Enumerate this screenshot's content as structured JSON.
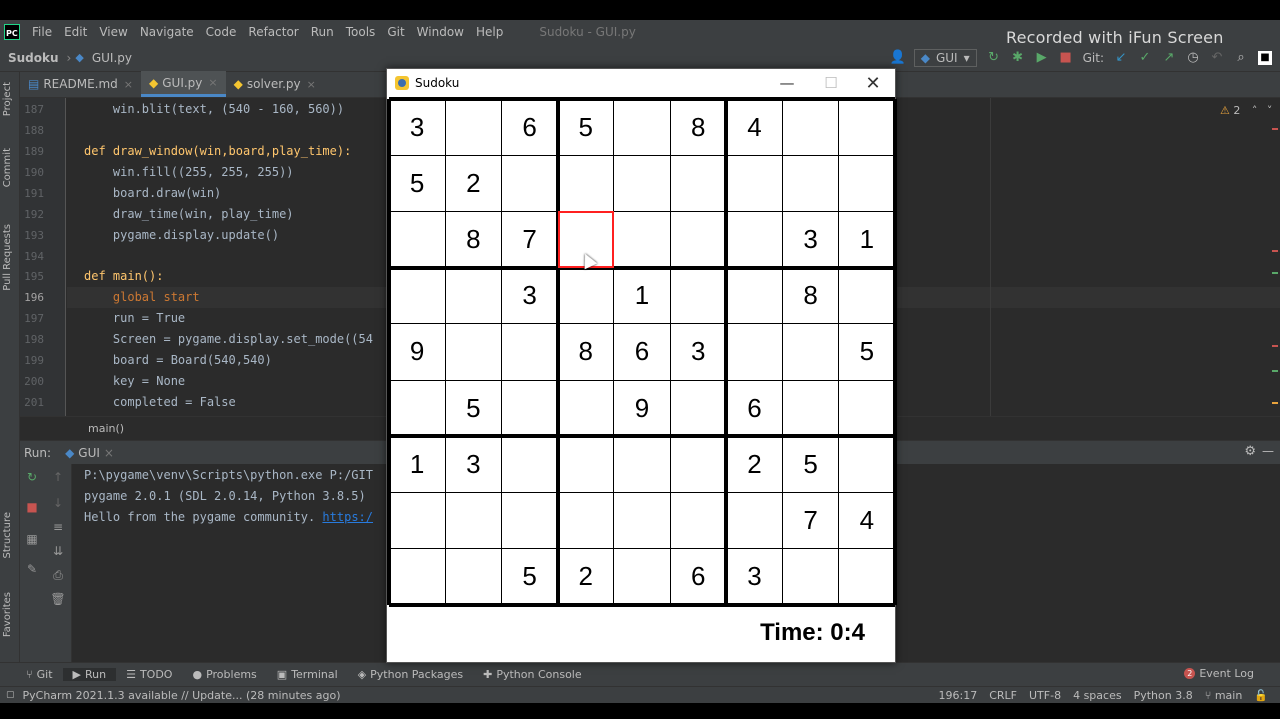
{
  "menubar": {
    "items": [
      "File",
      "Edit",
      "View",
      "Navigate",
      "Code",
      "Refactor",
      "Run",
      "Tools",
      "Git",
      "Window",
      "Help"
    ],
    "window_title": "Sudoku - GUI.py"
  },
  "watermark": "Recorded with iFun Screen Recorder",
  "navbar": {
    "project": "Sudoku",
    "file": "GUI.py",
    "run_config": "GUI",
    "git_label": "Git:"
  },
  "tabs": [
    {
      "label": "README.md",
      "active": false
    },
    {
      "label": "GUI.py",
      "active": true
    },
    {
      "label": "solver.py",
      "active": false
    }
  ],
  "left_tools": [
    "Project",
    "Commit",
    "Pull Requests",
    "Structure",
    "Favorites"
  ],
  "editor": {
    "warning_count": "2",
    "lines": [
      {
        "n": "187",
        "text": "    win.blit(text, (540 - 160, 560))"
      },
      {
        "n": "188",
        "text": ""
      },
      {
        "n": "189",
        "text": "def draw_window(win,board,play_time):"
      },
      {
        "n": "190",
        "text": "    win.fill((255, 255, 255))"
      },
      {
        "n": "191",
        "text": "    board.draw(win)"
      },
      {
        "n": "192",
        "text": "    draw_time(win, play_time)"
      },
      {
        "n": "193",
        "text": "    pygame.display.update()"
      },
      {
        "n": "194",
        "text": ""
      },
      {
        "n": "195",
        "text": "def main():"
      },
      {
        "n": "196",
        "text": "    global start"
      },
      {
        "n": "197",
        "text": "    run = True"
      },
      {
        "n": "198",
        "text": "    Screen = pygame.display.set_mode((54"
      },
      {
        "n": "199",
        "text": "    board = Board(540,540)"
      },
      {
        "n": "200",
        "text": "    key = None"
      },
      {
        "n": "201",
        "text": "    completed = False"
      }
    ],
    "breadcrumb": "main()"
  },
  "run": {
    "label": "Run:",
    "config": "GUI",
    "output": [
      "P:\\pygame\\venv\\Scripts\\python.exe P:/GIT",
      "pygame 2.0.1 (SDL 2.0.14, Python 3.8.5)",
      "Hello from the pygame community. "
    ],
    "link": "https:/"
  },
  "bottom_tools": [
    "Git",
    "Run",
    "TODO",
    "Problems",
    "Terminal",
    "Python Packages",
    "Python Console"
  ],
  "event_log": {
    "count": "2",
    "label": "Event Log"
  },
  "status": {
    "message": "PyCharm 2021.1.3 available // Update... (28 minutes ago)",
    "position": "196:17",
    "line_sep": "CRLF",
    "encoding": "UTF-8",
    "indent": "4 spaces",
    "interpreter": "Python 3.8",
    "branch": "main"
  },
  "pygame_window": {
    "title": "Sudoku",
    "timer": "Time:  0:4",
    "selected": {
      "row": 2,
      "col": 3
    },
    "grid": [
      [
        3,
        0,
        6,
        5,
        0,
        8,
        4,
        0,
        0
      ],
      [
        5,
        2,
        0,
        0,
        0,
        0,
        0,
        0,
        0
      ],
      [
        0,
        8,
        7,
        0,
        0,
        0,
        0,
        3,
        1
      ],
      [
        0,
        0,
        3,
        0,
        1,
        0,
        0,
        8,
        0
      ],
      [
        9,
        0,
        0,
        8,
        6,
        3,
        0,
        0,
        5
      ],
      [
        0,
        5,
        0,
        0,
        9,
        0,
        6,
        0,
        0
      ],
      [
        1,
        3,
        0,
        0,
        0,
        0,
        2,
        5,
        0
      ],
      [
        0,
        0,
        0,
        0,
        0,
        0,
        0,
        7,
        4
      ],
      [
        0,
        0,
        5,
        2,
        0,
        6,
        3,
        0,
        0
      ]
    ]
  }
}
